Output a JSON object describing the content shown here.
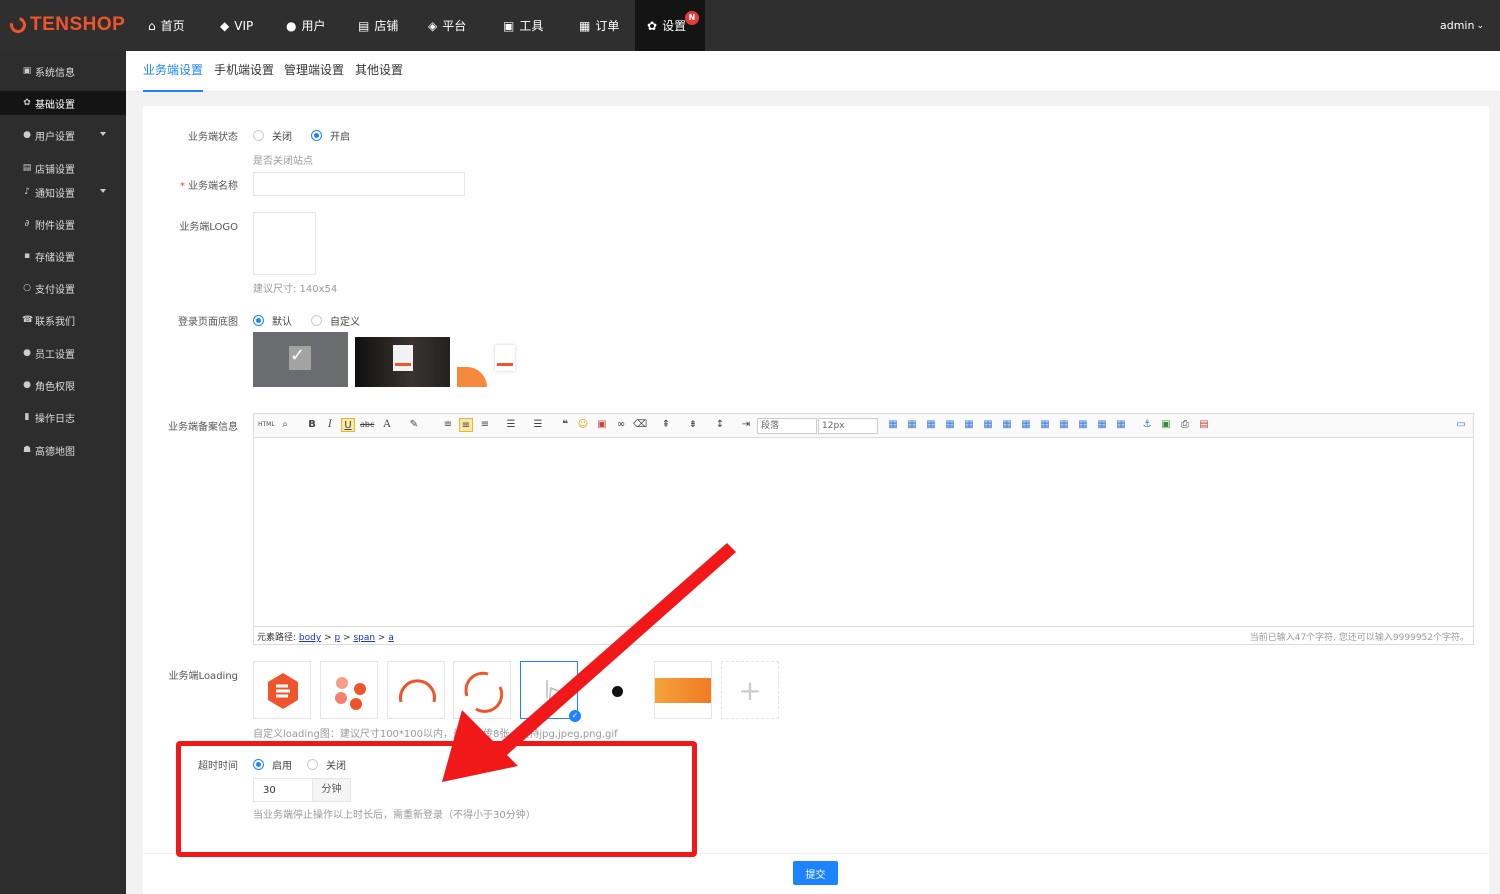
{
  "brand": "TENSHOP",
  "topnav": [
    {
      "label": "首页",
      "icon": "home-icon"
    },
    {
      "label": "VIP",
      "icon": "diamond-icon"
    },
    {
      "label": "用户",
      "icon": "users-icon"
    },
    {
      "label": "店铺",
      "icon": "store-icon"
    },
    {
      "label": "平台",
      "icon": "cube-icon"
    },
    {
      "label": "工具",
      "icon": "briefcase-icon"
    },
    {
      "label": "订单",
      "icon": "document-icon"
    },
    {
      "label": "设置",
      "icon": "gear-icon",
      "badge": "N"
    }
  ],
  "user": "admin",
  "sidebar": [
    {
      "label": "系统信息",
      "icon": "info-icon"
    },
    {
      "label": "基础设置",
      "icon": "gear-icon"
    },
    {
      "label": "用户设置",
      "icon": "user-icon"
    },
    {
      "label": "店铺设置",
      "icon": "store-icon"
    },
    {
      "label": "通知设置",
      "icon": "bell-icon"
    },
    {
      "label": "附件设置",
      "icon": "paperclip-icon"
    },
    {
      "label": "存储设置",
      "icon": "save-icon"
    },
    {
      "label": "支付设置",
      "icon": "circle-icon"
    },
    {
      "label": "联系我们",
      "icon": "phone-icon"
    },
    {
      "label": "员工设置",
      "icon": "user-icon"
    },
    {
      "label": "角色权限",
      "icon": "group-icon"
    },
    {
      "label": "操作日志",
      "icon": "log-icon"
    },
    {
      "label": "高德地图",
      "icon": "map-icon"
    }
  ],
  "tabs": [
    "业务端设置",
    "手机端设置",
    "管理端设置",
    "其他设置"
  ],
  "form": {
    "status_label": "业务端状态",
    "status_options": [
      "关闭",
      "开启"
    ],
    "status_hint": "是否关闭站点",
    "name_label": "业务端名称",
    "name_value": "",
    "logo_label": "业务端LOGO",
    "logo_hint": "建议尺寸: 140x54",
    "bg_label": "登录页面底图",
    "bg_options": [
      "默认",
      "自定义"
    ],
    "record_label": "业务端备案信息",
    "editor": {
      "paragraph_select": "段落",
      "size_select": "12px",
      "path_label": "元素路径:",
      "path": [
        "body",
        "p",
        "span",
        "a"
      ],
      "word_count": "当前已输入47个字符, 您还可以输入9999952个字符。"
    },
    "loading_label": "业务端Loading",
    "loading_hint": "自定义loading图：建议尺寸100*100以内，最多上传8张，支持jpg,jpeg,png,gif",
    "timeout_label": "超时时间",
    "timeout_options": [
      "启用",
      "关闭"
    ],
    "timeout_value": "30",
    "timeout_unit": "分钟",
    "timeout_hint": "当业务端停止操作以上时长后，需重新登录（不得小于30分钟）",
    "submit": "提交"
  },
  "colors": {
    "accent": "#1e83ff",
    "brand": "#f0542c",
    "highlight": "#f01818"
  }
}
